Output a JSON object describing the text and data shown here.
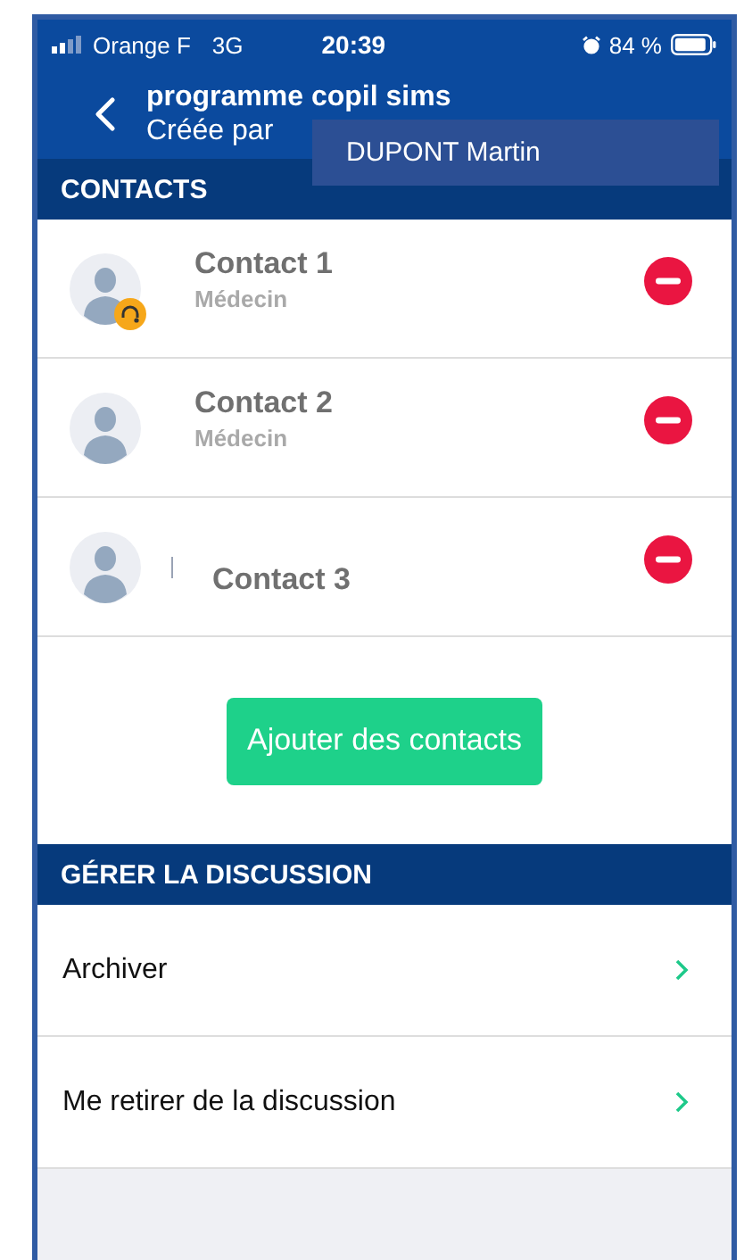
{
  "status_bar": {
    "carrier": "Orange F",
    "network": "3G",
    "time": "20:39",
    "battery": "84 %"
  },
  "header": {
    "title": "programme copil sims",
    "subtitle": "Créée par",
    "tooltip": "DUPONT Martin"
  },
  "contacts_section": {
    "title": "CONTACTS"
  },
  "contacts": [
    {
      "name": "Contact 1",
      "role": "Médecin",
      "badge": true,
      "cursor": false
    },
    {
      "name": "Contact 2",
      "role": "Médecin",
      "badge": false,
      "cursor": false
    },
    {
      "name": "Contact 3",
      "badge": false,
      "cursor": true
    }
  ],
  "add_button": "Ajouter des contacts",
  "manage_section": {
    "title": "GÉRER LA DISCUSSION"
  },
  "actions": [
    {
      "label": "Archiver"
    },
    {
      "label": "Me retirer de la discussion"
    }
  ]
}
